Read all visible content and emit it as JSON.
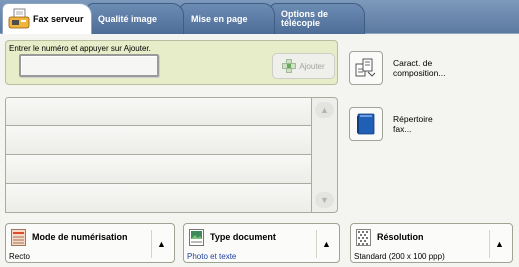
{
  "tabs": [
    {
      "label": "Fax serveur",
      "active": true
    },
    {
      "label": "Qualité image",
      "active": false
    },
    {
      "label": "Mise en page",
      "active": false
    },
    {
      "label_line1": "Options de",
      "label_line2": "télécopie",
      "active": false
    }
  ],
  "entry": {
    "label": "Entrer le numéro et appuyer sur Ajouter.",
    "value": "",
    "add_label": "Ajouter"
  },
  "list": {
    "rows": [
      "",
      "",
      "",
      ""
    ]
  },
  "side_buttons": {
    "compose_line1": "Caract. de",
    "compose_line2": "composition...",
    "directory": "Répertoire fax..."
  },
  "features": {
    "scan_mode": {
      "title": "Mode de numérisation",
      "value": "Recto"
    },
    "doc_type": {
      "title": "Type document",
      "value": "Photo et texte"
    },
    "resolution": {
      "title": "Résolution",
      "value": "Standard (200 x 100 ppp)"
    }
  },
  "icons": {
    "tab": "fax-machine-icon",
    "add": "add-recipient-icon",
    "compose": "build-job-icon",
    "directory": "fax-directory-icon",
    "scan_mode": "scan-mode-icon",
    "doc_type": "photo-document-icon",
    "resolution": "resolution-grid-icon"
  },
  "colors": {
    "tab_bar": "#5b7aa0",
    "entry_area": "#e7ecc9",
    "link_value": "#1f3fa0",
    "directory_icon": "#1f5fb6"
  }
}
